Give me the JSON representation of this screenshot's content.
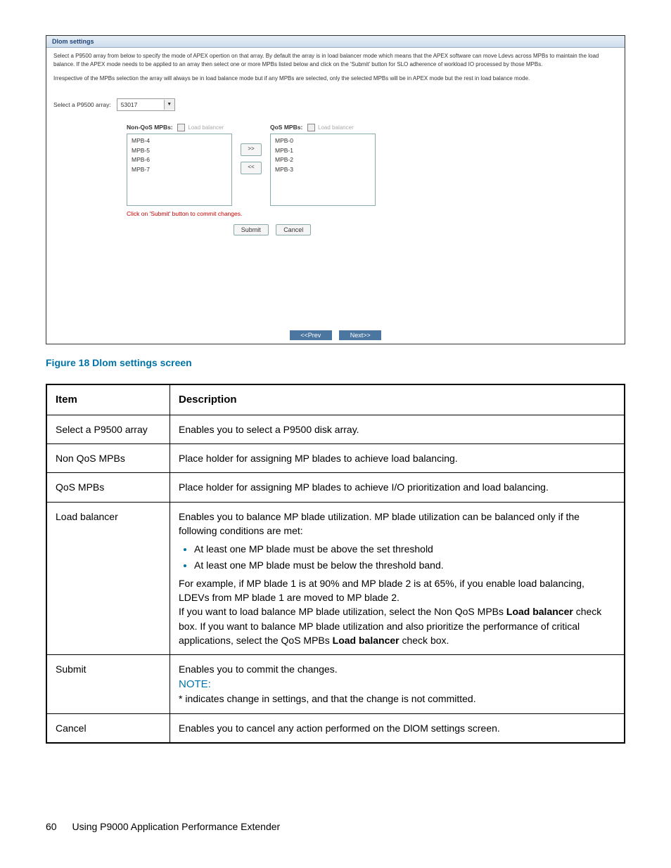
{
  "screenshot": {
    "panel_title": "Dlom settings",
    "instr1": "Select a P9500 array from below to specify the mode of APEX opertion on that array. By default the array is in load balancer mode which means that the APEX software can move Ldevs across MPBs to maintain the load balance. If the APEX mode needs to be applied to an array then select one or more MPBs listed below and click on the 'Submit' button for SLO adherence of workload IO processed by those MPBs.",
    "instr2": "Irrespective of the MPBs selection the array will always be in load balance mode but if any MPBs are selected, only the selected MPBs will be in APEX mode but the rest in load balance mode.",
    "select_label": "Select a P9500 array:",
    "select_value": "53017",
    "nonqos_label": "Non-QoS MPBs:",
    "lb_label": "Load balancer",
    "qos_label": "QoS MPBs:",
    "nonqos_items": [
      "MPB-4",
      "MPB-5",
      "MPB-6",
      "MPB-7"
    ],
    "qos_items": [
      "MPB-0",
      "MPB-1",
      "MPB-2",
      "MPB-3"
    ],
    "right_arrow": ">>",
    "left_arrow": "<<",
    "commit_note": "Click on 'Submit' button to commit changes.",
    "submit": "Submit",
    "cancel": "Cancel",
    "prev": "<<Prev",
    "next": "Next>>"
  },
  "caption": "Figure 18 Dlom settings screen",
  "table": {
    "h_item": "Item",
    "h_desc": "Description",
    "r1_item": "Select a P9500 array",
    "r1_desc": "Enables you to select a P9500 disk array.",
    "r2_item": "Non QoS MPBs",
    "r2_desc": "Place holder for assigning MP blades to achieve load balancing.",
    "r3_item": "QoS MPBs",
    "r3_desc": "Place holder for assigning MP blades to achieve I/O prioritization and load balancing.",
    "r4_item": "Load balancer",
    "r4_p1": "Enables you to balance MP blade utilization. MP blade utilization can be balanced only if the following conditions are met:",
    "r4_b1": "At least one MP blade must be above the set threshold",
    "r4_b2": "At least one MP blade must be below the threshold band.",
    "r4_p2": "For example, if MP blade 1 is at 90% and MP blade 2 is at 65%, if you enable load balancing, LDEVs from MP blade 1 are moved to MP blade 2.",
    "r4_p3a": "If you want to load balance MP blade utilization, select the Non QoS MPBs ",
    "r4_p3b": "Load balancer",
    "r4_p3c": " check box. If you want to balance MP blade utilization and also prioritize the performance of critical applications, select the QoS MPBs ",
    "r4_p3d": "Load balancer",
    "r4_p3e": " check box.",
    "r5_item": "Submit",
    "r5_p1": "Enables you to commit the changes.",
    "r5_note": "NOTE:",
    "r5_p2": "* indicates change in settings, and that the change is not committed.",
    "r6_item": "Cancel",
    "r6_desc": "Enables you to cancel any action performed on the DlOM settings screen."
  },
  "footer": {
    "page": "60",
    "title": "Using P9000 Application Performance Extender"
  }
}
